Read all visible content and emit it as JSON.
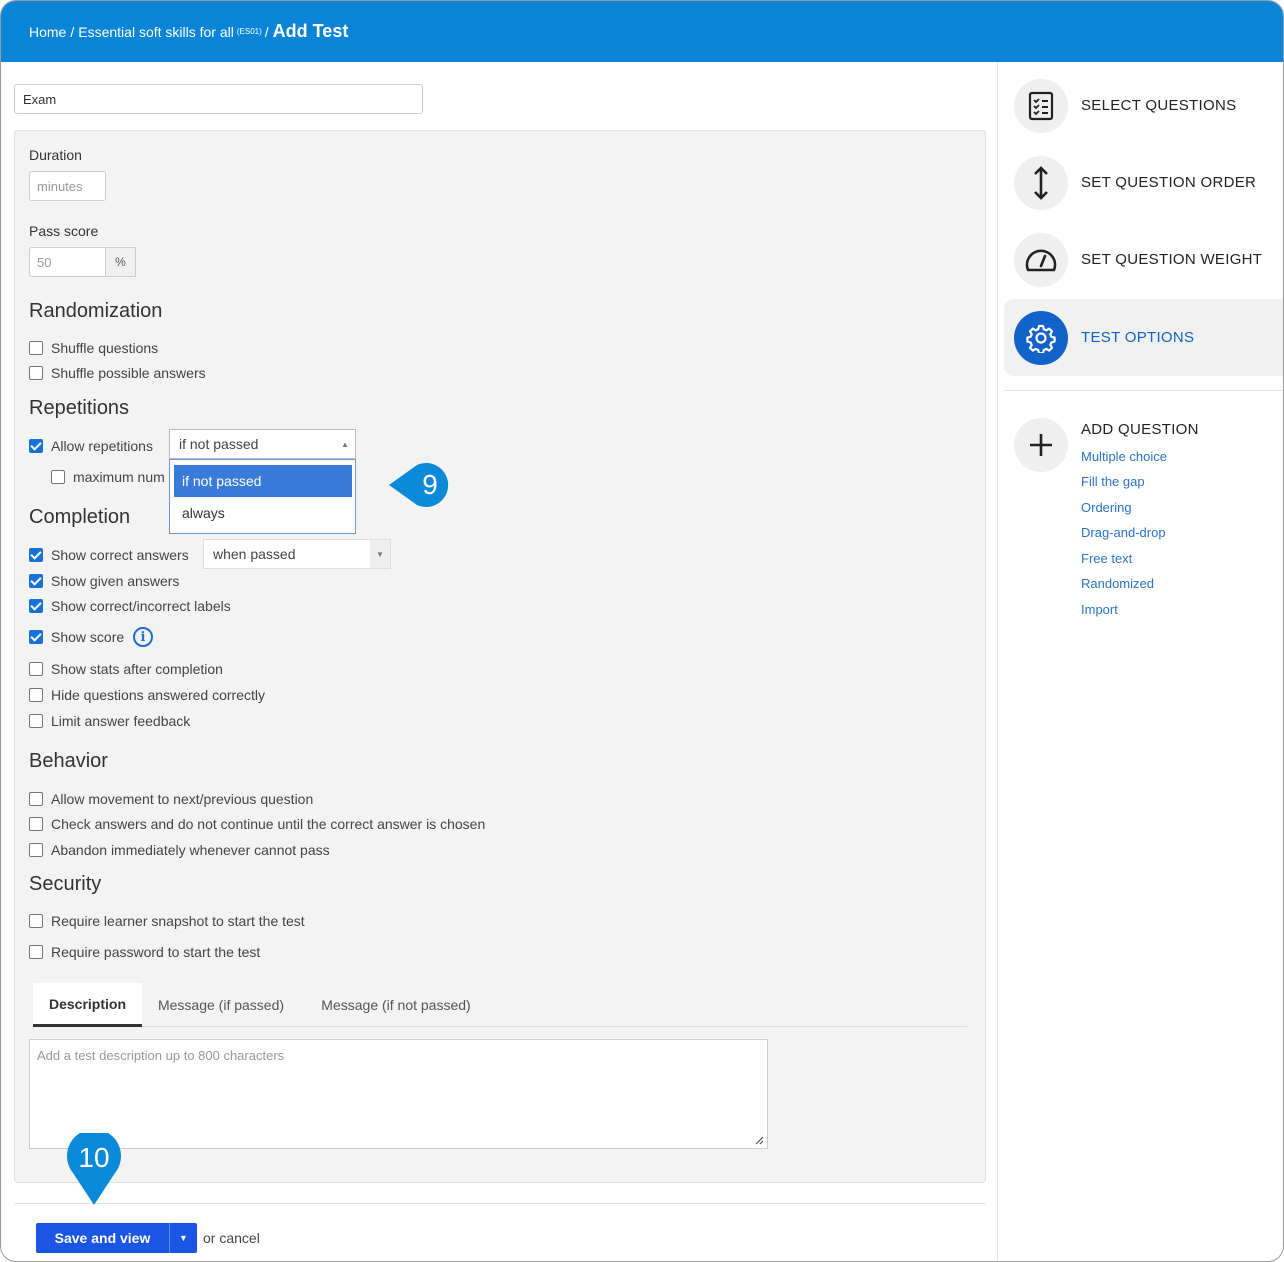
{
  "breadcrumb": {
    "home": "Home",
    "course": "Essential soft skills for all",
    "course_code": "(ES01)",
    "current": "Add Test",
    "separator": "/"
  },
  "form": {
    "title_value": "Exam",
    "duration_label": "Duration",
    "duration_placeholder": "minutes",
    "pass_score_label": "Pass score",
    "pass_score_value": "50",
    "pass_score_unit": "%"
  },
  "randomization": {
    "heading": "Randomization",
    "shuffle_questions": {
      "label": "Shuffle questions",
      "checked": false
    },
    "shuffle_answers": {
      "label": "Shuffle possible answers",
      "checked": false
    }
  },
  "repetitions": {
    "heading": "Repetitions",
    "allow_label": "Allow repetitions",
    "allow_checked": true,
    "select_value": "if not passed",
    "max_label": "maximum num",
    "max_checked": false,
    "dropdown_options": [
      "if not passed",
      "always"
    ],
    "dropdown_selected": "if not passed"
  },
  "completion": {
    "heading": "Completion",
    "show_correct": {
      "label": "Show correct answers",
      "checked": true
    },
    "show_correct_select": "when passed",
    "show_given": {
      "label": "Show given answers",
      "checked": true
    },
    "show_labels": {
      "label": "Show correct/incorrect labels",
      "checked": true
    },
    "show_score": {
      "label": "Show score",
      "checked": true
    },
    "show_stats": {
      "label": "Show stats after completion",
      "checked": false
    },
    "hide_correct": {
      "label": "Hide questions answered correctly",
      "checked": false
    },
    "limit_feedback": {
      "label": "Limit answer feedback",
      "checked": false
    }
  },
  "behavior": {
    "heading": "Behavior",
    "allow_movement": {
      "label": "Allow movement to next/previous question",
      "checked": false
    },
    "check_answers": {
      "label": "Check answers and do not continue until the correct answer is chosen",
      "checked": false
    },
    "abandon": {
      "label": "Abandon immediately whenever cannot pass",
      "checked": false
    }
  },
  "security": {
    "heading": "Security",
    "snapshot": {
      "label": "Require learner snapshot to start the test",
      "checked": false
    },
    "password": {
      "label": "Require password to start the test",
      "checked": false
    }
  },
  "tabs": [
    {
      "label": "Description",
      "active": true
    },
    {
      "label": "Message (if passed)",
      "active": false
    },
    {
      "label": "Message (if not passed)",
      "active": false
    }
  ],
  "description_placeholder": "Add a test description up to 800 characters",
  "actions": {
    "save_label": "Save and view",
    "cancel_text": "or cancel"
  },
  "callouts": {
    "step9": "9",
    "step10": "10"
  },
  "sidebar": {
    "items": [
      {
        "label": "SELECT QUESTIONS",
        "icon": "checklist-icon",
        "active": false
      },
      {
        "label": "SET QUESTION ORDER",
        "icon": "vertical-arrows-icon",
        "active": false
      },
      {
        "label": "SET QUESTION WEIGHT",
        "icon": "gauge-icon",
        "active": false
      },
      {
        "label": "TEST OPTIONS",
        "icon": "gear-icon",
        "active": true
      }
    ],
    "add_question": {
      "title": "ADD QUESTION",
      "links": [
        "Multiple choice",
        "Fill the gap",
        "Ordering",
        "Drag-and-drop",
        "Free text",
        "Randomized",
        "Import"
      ]
    }
  },
  "colors": {
    "header": "#0a84d6",
    "accent": "#1162c9",
    "primary_button": "#1a55e3",
    "callout": "#0a8ad8"
  }
}
